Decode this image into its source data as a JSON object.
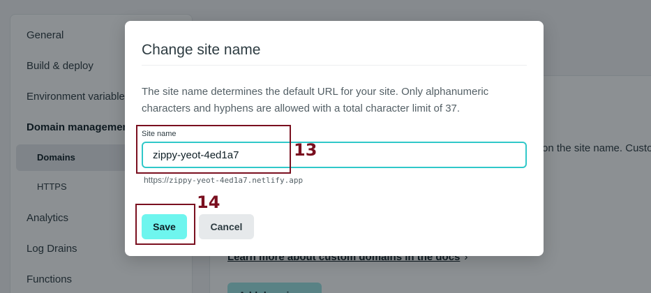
{
  "sidebar": {
    "items": [
      {
        "label": "General"
      },
      {
        "label": "Build & deploy"
      },
      {
        "label": "Environment variables"
      },
      {
        "label": "Domain management"
      },
      {
        "label": "Domains"
      },
      {
        "label": "HTTPS"
      },
      {
        "label": "Analytics"
      },
      {
        "label": "Log Drains"
      },
      {
        "label": "Functions"
      }
    ]
  },
  "background": {
    "partial_text": "on the site name. Custo",
    "learn_more_link": "Learn more about custom domains in the docs",
    "add_domain_button": "Add domain"
  },
  "modal": {
    "title": "Change site name",
    "description": "The site name determines the default URL for your site. Only alphanumeric characters and hyphens are allowed with a total character limit of 37.",
    "field_label": "Site name",
    "site_name_value": "zippy-yeot-4ed1a7",
    "url_prefix": "https://",
    "url_host": "zippy-yeot-4ed1a7.netlify.app",
    "save_label": "Save",
    "cancel_label": "Cancel"
  },
  "annotations": {
    "input_step": "13",
    "save_step": "14",
    "color": "#7a0f1f"
  },
  "colors": {
    "accent": "#30c8c9",
    "primary_button": "#6ef5ee"
  }
}
